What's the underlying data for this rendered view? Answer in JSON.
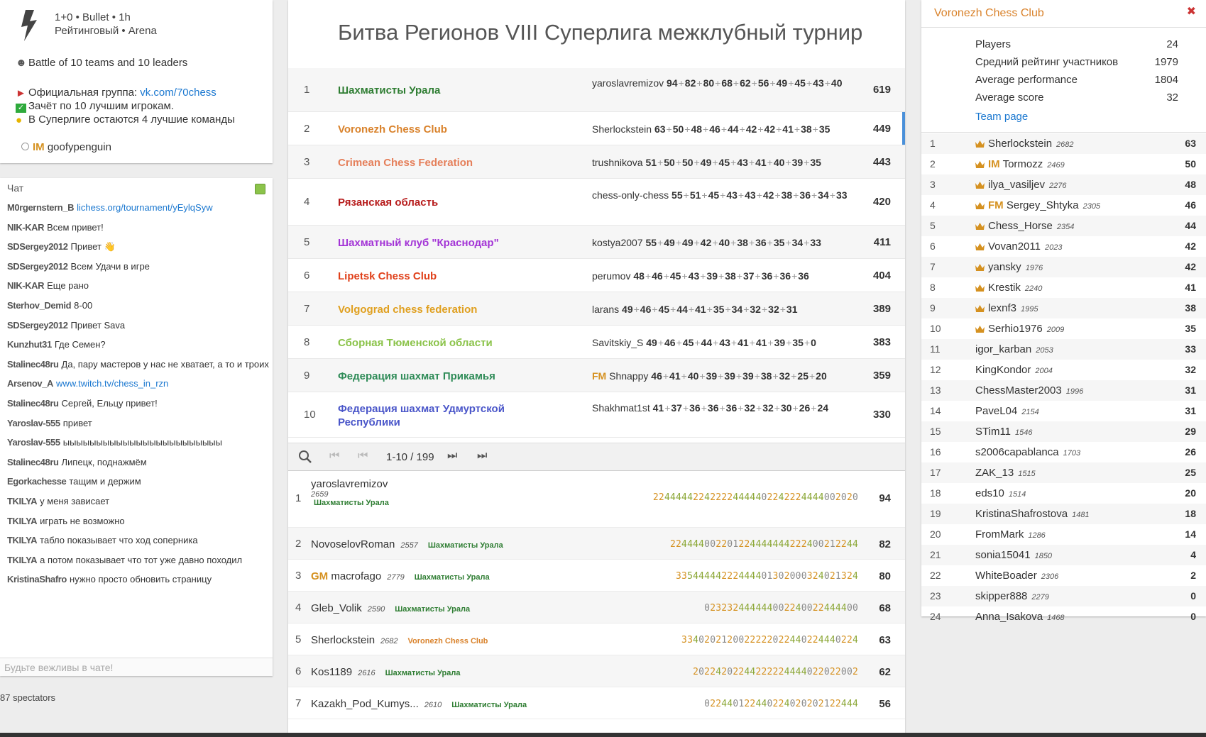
{
  "info": {
    "clock": "1+0 • Bullet • 1h",
    "mode": "Рейтинговый • Arena",
    "battle": "Battle of 10 teams and 10 leaders",
    "group_prefix": "Официальная группа: ",
    "group_link": "vk.com/70chess",
    "rule1": "Зачёт по 10 лучшим игрокам.",
    "rule2": "В Суперлиге остаются 4 лучшие команды",
    "creator_title": "IM",
    "creator_name": "goofypenguin"
  },
  "chat": {
    "heading": "Чат",
    "placeholder": "Будьте вежливы в чате!",
    "messages": [
      {
        "user": "M0rgernstern_B",
        "text": "",
        "link": "lichess.org/tournament/yEylqSyw"
      },
      {
        "user": "NIK-KAR",
        "text": "Всем привет!",
        "link": ""
      },
      {
        "user": "SDSergey2012",
        "text": "Привет 👋",
        "link": ""
      },
      {
        "user": "SDSergey2012",
        "text": "Всем Удачи в игре",
        "link": ""
      },
      {
        "user": "NIK-KAR",
        "text": "Еще рано",
        "link": ""
      },
      {
        "user": "Sterhov_Demid",
        "text": "8-00",
        "link": ""
      },
      {
        "user": "SDSergey2012",
        "text": "Привет Sava",
        "link": ""
      },
      {
        "user": "Kunzhut31",
        "text": "Где Семен?",
        "link": ""
      },
      {
        "user": "Stalinec48ru",
        "text": "Да, пару мастеров у нас не хватает, а то и троих",
        "link": ""
      },
      {
        "user": "Arsenov_A",
        "text": "",
        "link": "www.twitch.tv/chess_in_rzn"
      },
      {
        "user": "Stalinec48ru",
        "text": "Сергей, Ельцу привет!",
        "link": ""
      },
      {
        "user": "Yaroslav-555",
        "text": "привет",
        "link": ""
      },
      {
        "user": "Yaroslav-555",
        "text": "ыыыыыыыыыыыыыыыыыыыыыыыы",
        "link": ""
      },
      {
        "user": "Stalinec48ru",
        "text": "Липецк, поднажмём",
        "link": ""
      },
      {
        "user": "Egorkachesse",
        "text": "тащим и держим",
        "link": ""
      },
      {
        "user": "TKILYA",
        "text": "у меня зависает",
        "link": ""
      },
      {
        "user": "TKILYA",
        "text": "играть не возможно",
        "link": ""
      },
      {
        "user": "TKILYA",
        "text": "табло показывает что ход соперника",
        "link": ""
      },
      {
        "user": "TKILYA",
        "text": "а потом показывает что тот уже давно походил",
        "link": ""
      },
      {
        "user": "KristinaShafro",
        "text": "нужно просто обновить страницу",
        "link": ""
      }
    ],
    "spectators": "87 spectators"
  },
  "tournament": {
    "title": "Битва Регионов VIII Суперлига межклубный турнир",
    "teams": [
      {
        "rank": "1",
        "name": "Шахматисты Урала",
        "color": "#2e7d32",
        "leader": "yaroslavremizov",
        "leader_title": "",
        "scores": [
          "94",
          "82",
          "80",
          "68",
          "62",
          "56",
          "49",
          "45",
          "43",
          "40"
        ],
        "score": "619",
        "h": 62
      },
      {
        "rank": "2",
        "name": "Voronezh Chess Club",
        "color": "#d9822b",
        "leader": "Sherlockstein",
        "leader_title": "",
        "scores": [
          "63",
          "50",
          "48",
          "46",
          "44",
          "42",
          "42",
          "41",
          "38",
          "35"
        ],
        "score": "449",
        "h": 47,
        "sel": true
      },
      {
        "rank": "3",
        "name": "Crimean Chess Federation",
        "color": "#e57f5a",
        "leader": "trushnikova",
        "leader_title": "",
        "scores": [
          "51",
          "50",
          "50",
          "49",
          "45",
          "43",
          "41",
          "40",
          "39",
          "35"
        ],
        "score": "443",
        "h": 47
      },
      {
        "rank": "4",
        "name": "Рязанская область",
        "color": "#b71c1c",
        "leader": "chess-only-chess",
        "leader_title": "",
        "scores": [
          "55",
          "51",
          "45",
          "43",
          "43",
          "42",
          "38",
          "36",
          "34",
          "33"
        ],
        "score": "420",
        "h": 66
      },
      {
        "rank": "5",
        "name": "Шахматный клуб \"Краснодар\"",
        "color": "#a334d6",
        "leader": "kostya2007",
        "leader_title": "",
        "scores": [
          "55",
          "49",
          "49",
          "42",
          "40",
          "38",
          "36",
          "35",
          "34",
          "33"
        ],
        "score": "411",
        "h": 47
      },
      {
        "rank": "6",
        "name": "Lipetsk Chess Club",
        "color": "#e0401a",
        "leader": "perumov",
        "leader_title": "",
        "scores": [
          "48",
          "46",
          "45",
          "43",
          "39",
          "38",
          "37",
          "36",
          "36",
          "36"
        ],
        "score": "404",
        "h": 47
      },
      {
        "rank": "7",
        "name": "Volgograd chess federation",
        "color": "#e0a020",
        "leader": "larans",
        "leader_title": "",
        "scores": [
          "49",
          "46",
          "45",
          "44",
          "41",
          "35",
          "34",
          "32",
          "32",
          "31"
        ],
        "score": "389",
        "h": 47
      },
      {
        "rank": "8",
        "name": "Сборная Тюменской области",
        "color": "#8bc34a",
        "leader": "Savitskiy_S",
        "leader_title": "",
        "scores": [
          "49",
          "46",
          "45",
          "44",
          "43",
          "41",
          "41",
          "39",
          "35",
          "0"
        ],
        "score": "383",
        "h": 47
      },
      {
        "rank": "9",
        "name": "Федерация шахмат Прикамья",
        "color": "#2e8b57",
        "leader": "Shnappy",
        "leader_title": "FM",
        "scores": [
          "46",
          "41",
          "40",
          "39",
          "39",
          "39",
          "38",
          "32",
          "25",
          "20"
        ],
        "score": "359",
        "h": 47
      },
      {
        "rank": "10",
        "name": "Федерация шахмат Удмуртской Республики",
        "color": "#4a56c9",
        "leader": "Shakhmat1st",
        "leader_title": "",
        "scores": [
          "41",
          "37",
          "36",
          "36",
          "36",
          "32",
          "32",
          "30",
          "26",
          "24"
        ],
        "score": "330",
        "h": 64
      }
    ],
    "pager": {
      "count": "1-10 / 199"
    },
    "players": [
      {
        "rank": "1",
        "title": "",
        "name": "yaroslavremizov",
        "rating": "2659",
        "team": "Шахматисты Урала",
        "team_color": "#2e7d32",
        "sheet": "22444442242222444440224222444400 2020",
        "score": "94"
      },
      {
        "rank": "2",
        "title": "",
        "name": "NovoselovRoman",
        "rating": "2557",
        "team": "Шахматисты Урала",
        "team_color": "#2e7d32",
        "sheet": "224444002201224444444222400212244",
        "score": "82"
      },
      {
        "rank": "3",
        "title": "GM",
        "name": "macrofago",
        "rating": "2779",
        "team": "Шахматисты Урала",
        "team_color": "#2e7d32",
        "sheet": "335444442224444013020003240213 24",
        "score": "80"
      },
      {
        "rank": "4",
        "title": "",
        "name": "Gleb_Volik",
        "rating": "2590",
        "team": "Шахматисты Урала",
        "team_color": "#2e7d32",
        "sheet": "02323244444400224002244440 0",
        "score": "68"
      },
      {
        "rank": "5",
        "title": "",
        "name": "Sherlockstein",
        "rating": "2682",
        "team": "Voronezh Chess Club",
        "team_color": "#d9822b",
        "sheet": "334020212002222202244022444 0224",
        "score": "63"
      },
      {
        "rank": "6",
        "title": "",
        "name": "Kos1189",
        "rating": "2616",
        "team": "Шахматисты Урала",
        "team_color": "#2e7d32",
        "sheet": "2022420224422222444402202200 2",
        "score": "62"
      },
      {
        "rank": "7",
        "title": "",
        "name": "Kazakh_Pod_Kumys...",
        "rating": "2610",
        "team": "Шахматисты Урала",
        "team_color": "#2e7d32",
        "sheet": "02244012244022402020212 2444",
        "score": "56"
      }
    ]
  },
  "team_panel": {
    "name": "Voronezh Chess Club",
    "stats": [
      {
        "label": "Players",
        "value": "24"
      },
      {
        "label": "Средний рейтинг участников",
        "value": "1979"
      },
      {
        "label": "Average performance",
        "value": "1804"
      },
      {
        "label": "Average score",
        "value": "32"
      }
    ],
    "team_page": "Team page",
    "roster": [
      {
        "rank": "1",
        "title": "",
        "name": "Sherlockstein",
        "rating": "2682",
        "score": "63",
        "leader": true
      },
      {
        "rank": "2",
        "title": "IM",
        "name": "Tormozz",
        "rating": "2469",
        "score": "50",
        "leader": true
      },
      {
        "rank": "3",
        "title": "",
        "name": "ilya_vasiljev",
        "rating": "2276",
        "score": "48",
        "leader": true
      },
      {
        "rank": "4",
        "title": "FM",
        "name": "Sergey_Shtyka",
        "rating": "2305",
        "score": "46",
        "leader": true
      },
      {
        "rank": "5",
        "title": "",
        "name": "Chess_Horse",
        "rating": "2354",
        "score": "44",
        "leader": true
      },
      {
        "rank": "6",
        "title": "",
        "name": "Vovan2011",
        "rating": "2023",
        "score": "42",
        "leader": true
      },
      {
        "rank": "7",
        "title": "",
        "name": "yansky",
        "rating": "1976",
        "score": "42",
        "leader": true
      },
      {
        "rank": "8",
        "title": "",
        "name": "Krestik",
        "rating": "2240",
        "score": "41",
        "leader": true
      },
      {
        "rank": "9",
        "title": "",
        "name": "lexnf3",
        "rating": "1995",
        "score": "38",
        "leader": true
      },
      {
        "rank": "10",
        "title": "",
        "name": "Serhio1976",
        "rating": "2009",
        "score": "35",
        "leader": true
      },
      {
        "rank": "11",
        "title": "",
        "name": "igor_karban",
        "rating": "2053",
        "score": "33",
        "leader": false
      },
      {
        "rank": "12",
        "title": "",
        "name": "KingKondor",
        "rating": "2004",
        "score": "32",
        "leader": false
      },
      {
        "rank": "13",
        "title": "",
        "name": "ChessMaster2003",
        "rating": "1996",
        "score": "31",
        "leader": false
      },
      {
        "rank": "14",
        "title": "",
        "name": "PaveL04",
        "rating": "2154",
        "score": "31",
        "leader": false
      },
      {
        "rank": "15",
        "title": "",
        "name": "STim11",
        "rating": "1546",
        "score": "29",
        "leader": false
      },
      {
        "rank": "16",
        "title": "",
        "name": "s2006capablanca",
        "rating": "1703",
        "score": "26",
        "leader": false
      },
      {
        "rank": "17",
        "title": "",
        "name": "ZAK_13",
        "rating": "1515",
        "score": "25",
        "leader": false
      },
      {
        "rank": "18",
        "title": "",
        "name": "eds10",
        "rating": "1514",
        "score": "20",
        "leader": false
      },
      {
        "rank": "19",
        "title": "",
        "name": "KristinaShafrostova",
        "rating": "1481",
        "score": "18",
        "leader": false
      },
      {
        "rank": "20",
        "title": "",
        "name": "FromMark",
        "rating": "1286",
        "score": "14",
        "leader": false
      },
      {
        "rank": "21",
        "title": "",
        "name": "sonia15041",
        "rating": "1850",
        "score": "4",
        "leader": false
      },
      {
        "rank": "22",
        "title": "",
        "name": "WhiteBoader",
        "rating": "2306",
        "score": "2",
        "leader": false
      },
      {
        "rank": "23",
        "title": "",
        "name": "skipper888",
        "rating": "2279",
        "score": "0",
        "leader": false
      },
      {
        "rank": "24",
        "title": "",
        "name": "Anna_Isakova",
        "rating": "1468",
        "score": "0",
        "leader": false
      }
    ]
  }
}
